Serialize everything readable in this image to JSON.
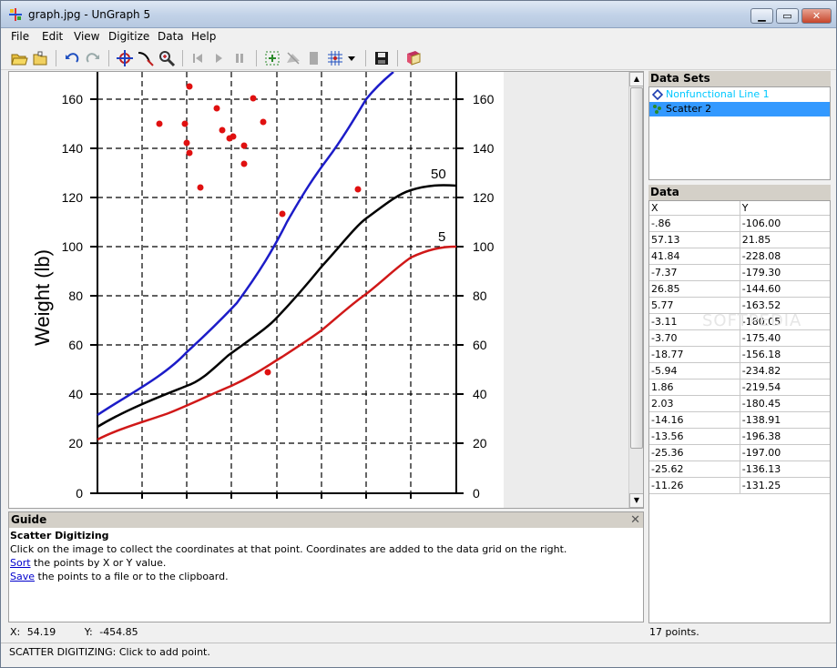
{
  "window": {
    "title": "graph.jpg - UnGraph 5"
  },
  "menu": [
    "File",
    "Edit",
    "View",
    "Digitize",
    "Data",
    "Help"
  ],
  "colors": {
    "blue_curve": "#1c1cc8",
    "black_curve": "#000000",
    "red_curve": "#d01818",
    "selection": "#3399ff",
    "dataset_link": "#00c8ff"
  },
  "plot": {
    "ylabel": "Weight (lb)",
    "y_ticks_left": [
      "160",
      "140",
      "120",
      "100",
      "80",
      "60",
      "40",
      "20",
      "0"
    ],
    "y_ticks_right": [
      "160",
      "140",
      "120",
      "100",
      "80",
      "60",
      "40",
      "20",
      "0"
    ],
    "curve_labels": [
      "50",
      "5"
    ]
  },
  "guide": {
    "header": "Guide",
    "title": "Scatter Digitizing",
    "line1": "Click on the image to collect the coordinates at that point. Coordinates are added to the data grid on the right.",
    "sort_link": "Sort",
    "sort_text": " the points by X or Y value.",
    "save_link": "Save",
    "save_text": " the points to a file or to the clipboard."
  },
  "coords": {
    "x_label": "X:",
    "x_value": "54.19",
    "y_label": "Y:",
    "y_value": "-454.85"
  },
  "datasets": {
    "header": "Data Sets",
    "items": [
      "Nonfunctional Line 1",
      "Scatter 2"
    ]
  },
  "data": {
    "header": "Data",
    "columns": [
      "X",
      "Y"
    ],
    "rows": [
      [
        "-.86",
        "-106.00"
      ],
      [
        "57.13",
        "21.85"
      ],
      [
        "41.84",
        "-228.08"
      ],
      [
        "-7.37",
        "-179.30"
      ],
      [
        "26.85",
        "-144.60"
      ],
      [
        "5.77",
        "-163.52"
      ],
      [
        "-3.11",
        "-180.05"
      ],
      [
        "-3.70",
        "-175.40"
      ],
      [
        "-18.77",
        "-156.18"
      ],
      [
        "-5.94",
        "-234.82"
      ],
      [
        "1.86",
        "-219.54"
      ],
      [
        "2.03",
        "-180.45"
      ],
      [
        "-14.16",
        "-138.91"
      ],
      [
        "-13.56",
        "-196.38"
      ],
      [
        "-25.36",
        "-197.00"
      ],
      [
        "-25.62",
        "-136.13"
      ],
      [
        "-11.26",
        "-131.25"
      ]
    ],
    "points_count": "17 points."
  },
  "watermark": "SOFTPEDIA",
  "status": "SCATTER DIGITIZING: Click to add point."
}
